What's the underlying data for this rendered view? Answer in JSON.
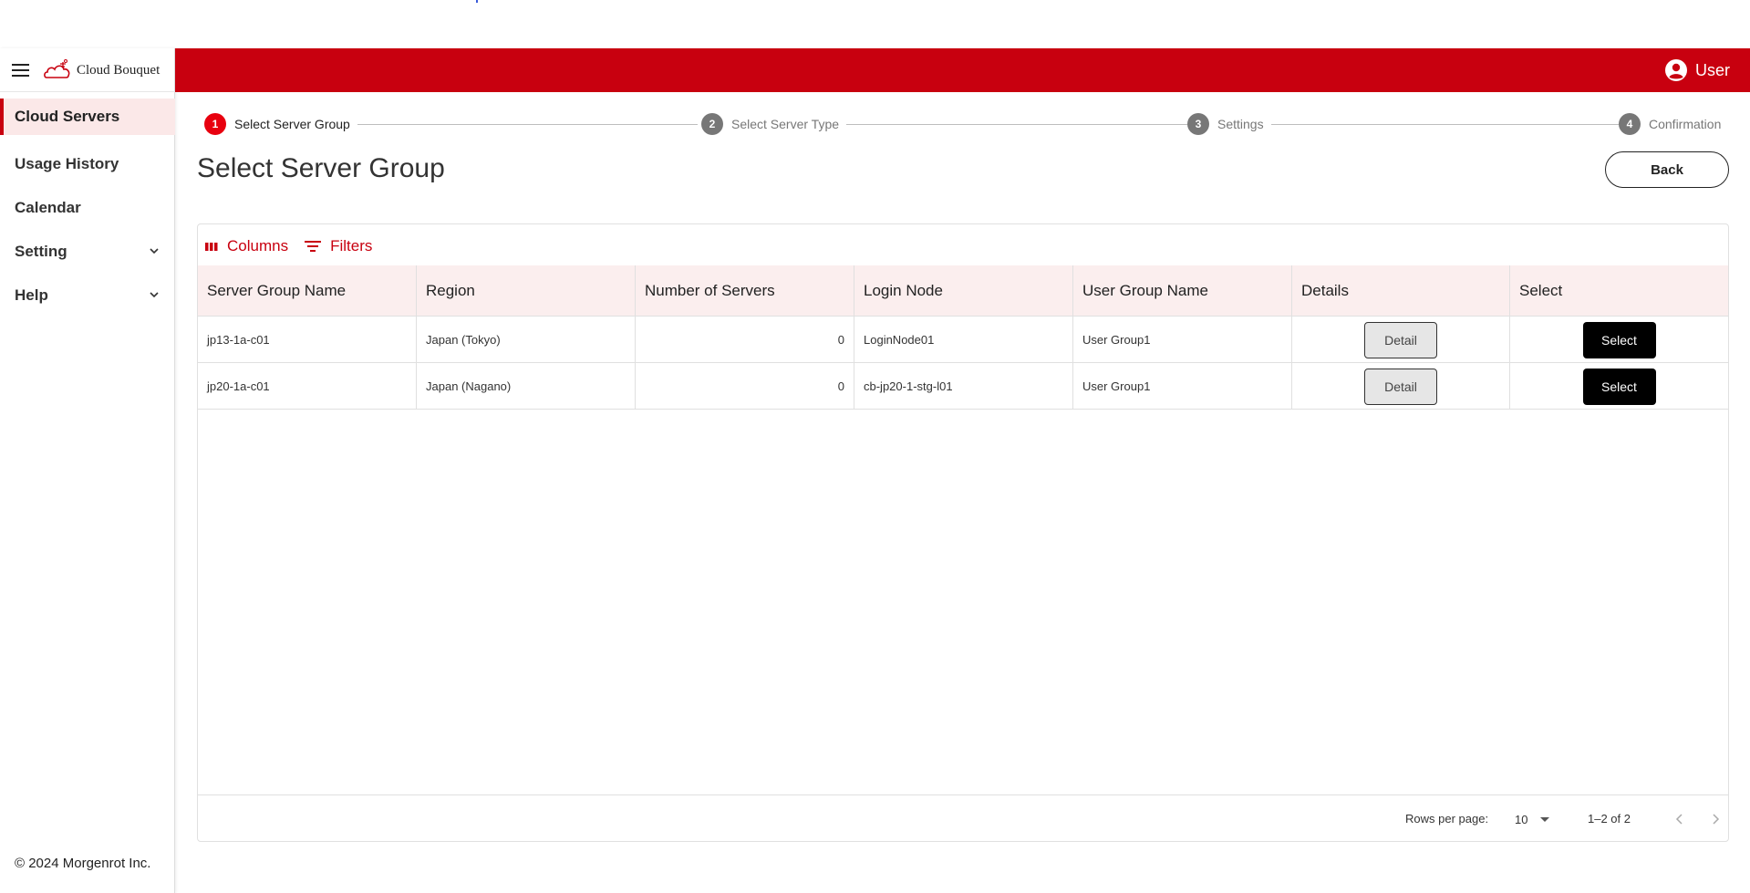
{
  "brand": {
    "name": "Cloud Bouquet"
  },
  "header": {
    "user_label": "User"
  },
  "sidebar": {
    "items": [
      {
        "label": "Cloud Servers",
        "active": true
      },
      {
        "label": "Usage History"
      },
      {
        "label": "Calendar"
      },
      {
        "label": "Setting",
        "expandable": true
      },
      {
        "label": "Help",
        "expandable": true
      }
    ],
    "copyright": "© 2024 Morgenrot Inc."
  },
  "stepper": {
    "steps": [
      {
        "num": "1",
        "label": "Select Server Group",
        "active": true
      },
      {
        "num": "2",
        "label": "Select Server Type"
      },
      {
        "num": "3",
        "label": "Settings"
      },
      {
        "num": "4",
        "label": "Confirmation"
      }
    ]
  },
  "page": {
    "title": "Select Server Group",
    "back_label": "Back"
  },
  "grid": {
    "toolbar": {
      "columns_label": "Columns",
      "filters_label": "Filters"
    },
    "columns": [
      "Server Group Name",
      "Region",
      "Number of Servers",
      "Login Node",
      "User Group Name",
      "Details",
      "Select"
    ],
    "rows": [
      {
        "name": "jp13-1a-c01",
        "region": "Japan (Tokyo)",
        "servers": "0",
        "login_node": "LoginNode01",
        "user_group": "User Group1",
        "detail_label": "Detail",
        "select_label": "Select"
      },
      {
        "name": "jp20-1a-c01",
        "region": "Japan (Nagano)",
        "servers": "0",
        "login_node": "cb-jp20-1-stg-l01",
        "user_group": "User Group1",
        "detail_label": "Detail",
        "select_label": "Select"
      }
    ],
    "footer": {
      "rows_per_page_label": "Rows per page:",
      "rows_per_page": "10",
      "range": "1–2 of 2"
    }
  },
  "colors": {
    "brand_red": "#c8000f",
    "active_step": "#e8000f",
    "header_row_bg": "#fbeeee"
  }
}
